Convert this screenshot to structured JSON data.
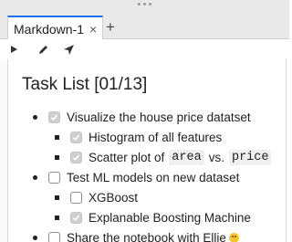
{
  "window": {
    "tab": {
      "label": "Markdown-1",
      "close": "×",
      "add": "+"
    },
    "toolbar": [
      {
        "name": "run-icon"
      },
      {
        "name": "edit-icon"
      },
      {
        "name": "send-icon"
      }
    ]
  },
  "doc": {
    "title": "Task List [01/13]",
    "items": [
      {
        "text": "Visualize the house price datatset",
        "checked": true
      },
      {
        "text": "Histogram of all features",
        "checked": true
      },
      {
        "text_before": "Scatter plot of",
        "code1": "area",
        "text_mid": "vs.",
        "code2": "price",
        "checked": true
      },
      {
        "text": "Test ML models on new dataset",
        "checked": false
      },
      {
        "text": "XGBoost",
        "checked": false
      },
      {
        "text": "Explanable Boosting Machine",
        "checked": true
      },
      {
        "text": "Share the notebook with Ellie",
        "emoji": "slightly-smiling-face",
        "checked": false
      }
    ]
  }
}
